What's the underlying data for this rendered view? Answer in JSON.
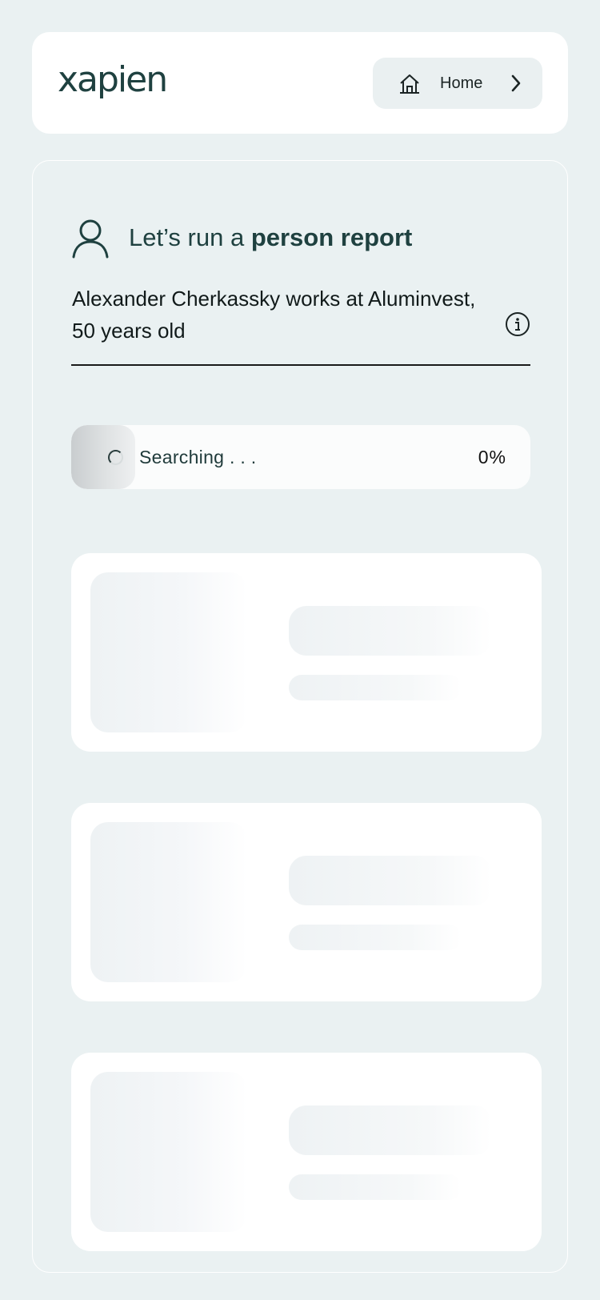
{
  "header": {
    "logo": "xapien",
    "home_button": {
      "label": "Home",
      "icon": "home-icon",
      "chevron": "chevron-right-icon"
    }
  },
  "report": {
    "icon": "person-icon",
    "title_prefix": "Let’s run a ",
    "title_bold": "person report",
    "query": "Alexander Cherkassky works at Aluminvest, 50 years old",
    "info_icon": "info-icon"
  },
  "progress": {
    "label": "Searching . . .",
    "percent_text": "0%",
    "value": 0
  },
  "colors": {
    "background": "#eaf1f2",
    "brand_text": "#1f4140"
  }
}
